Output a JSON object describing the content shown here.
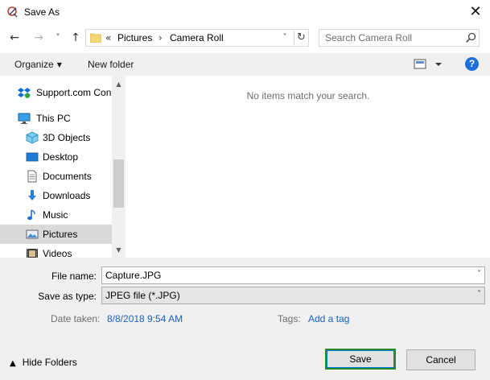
{
  "window": {
    "title": "Save As",
    "close_glyph": "✕"
  },
  "nav": {
    "back_glyph": "←",
    "forward_glyph": "→",
    "recent_glyph": "˅",
    "up_glyph": "↑"
  },
  "address": {
    "overflow": "«",
    "crumbs": [
      "Pictures",
      "Camera Roll"
    ],
    "separator": "›",
    "dropdown_glyph": "˅",
    "refresh_glyph": "↻"
  },
  "search": {
    "placeholder": "Search Camera Roll"
  },
  "toolbar": {
    "organize_label": "Organize",
    "organize_caret": "▼",
    "new_folder_label": "New folder",
    "help_label": "?"
  },
  "navpane": {
    "items": [
      {
        "label": "Support.com Con",
        "icon": "dropbox-icon"
      },
      {
        "label": "This PC",
        "icon": "computer-icon"
      },
      {
        "label": "3D Objects",
        "icon": "cube-icon"
      },
      {
        "label": "Desktop",
        "icon": "desktop-icon"
      },
      {
        "label": "Documents",
        "icon": "document-icon"
      },
      {
        "label": "Downloads",
        "icon": "download-arrow-icon"
      },
      {
        "label": "Music",
        "icon": "music-note-icon"
      },
      {
        "label": "Pictures",
        "icon": "pictures-icon",
        "selected": true
      },
      {
        "label": "Videos",
        "icon": "film-icon"
      }
    ],
    "scroll_up_glyph": "▲",
    "scroll_down_glyph": "▼"
  },
  "content": {
    "empty_message": "No items match your search."
  },
  "form": {
    "file_name_label": "File name:",
    "file_name_value": "Capture.JPG",
    "save_type_label": "Save as type:",
    "save_type_value": "JPEG file (*.JPG)",
    "caret": "˅",
    "date_taken_label": "Date taken:",
    "date_taken_value": "8/8/2018 9:54 AM",
    "tags_label": "Tags:",
    "tags_value": "Add a tag"
  },
  "footer": {
    "hide_folders_caret": "▲",
    "hide_folders_label": "Hide Folders",
    "save_label": "Save",
    "cancel_label": "Cancel"
  },
  "colors": {
    "accent": "#1e6fd9",
    "link": "#1a61b8",
    "selected_row": "#d9d9d9",
    "default_button_border": "#2b8a2b"
  }
}
